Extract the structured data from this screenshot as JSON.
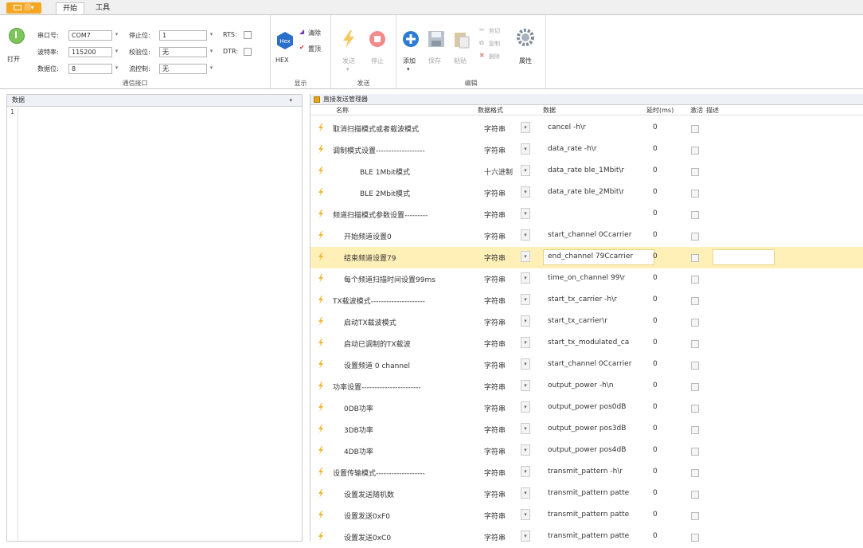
{
  "tabs": {
    "app": "🗐▾",
    "start": "开始",
    "tools": "工具"
  },
  "serial": {
    "port_label": "串口号:",
    "port_value": "COM7",
    "stop_label": "停止位:",
    "stop_value": "1",
    "baud_label": "波特率:",
    "baud_value": "115200",
    "parity_label": "校验位:",
    "parity_value": "无",
    "data_label": "数据位:",
    "data_value": "8",
    "flow_label": "流控制:",
    "flow_value": "无",
    "rts_label": "RTS:",
    "dtr_label": "DTR:",
    "open_label": "打开",
    "group_label": "通信接口"
  },
  "display": {
    "hex_badge": "Hex",
    "hex_label": "HEX",
    "clear_label": "清除",
    "top_label": "置顶",
    "group_label": "显示"
  },
  "send": {
    "send_label": "发送",
    "stop_label": "停止",
    "group_label": "发送"
  },
  "edit": {
    "add_label": "添加",
    "save_label": "保存",
    "paste_label": "粘贴",
    "cut_label": "剪切",
    "copy_label": "复制",
    "delete_label": "删除",
    "props_label": "属性",
    "group_label": "编辑"
  },
  "left_panel": {
    "title": "数据",
    "dropdown": "▾",
    "line1": "1"
  },
  "right_panel": {
    "title": "直接发送管理器",
    "columns": {
      "name": "名称",
      "format": "数据格式",
      "data": "数据",
      "delay": "延时(ms)",
      "active": "激活",
      "desc": "描述"
    },
    "rows": [
      {
        "name": "取消扫描模式或者载波模式",
        "format": "字符串",
        "data": "cancel -h\\r",
        "delay": "0"
      },
      {
        "name": "调制模式设置-------------------",
        "format": "字符串",
        "data": "data_rate -h\\r",
        "delay": "0"
      },
      {
        "name": "BLE 1Mbit模式",
        "format": "十六进制",
        "data": "data_rate ble_1Mbit\\r",
        "delay": "0"
      },
      {
        "name": "BLE 2Mbit模式",
        "format": "字符串",
        "data": "data_rate ble_2Mbit\\r",
        "delay": "0"
      },
      {
        "name": "频道扫描模式参数设置---------",
        "format": "字符串",
        "data": "",
        "delay": "0"
      },
      {
        "name": "开始频道设置0",
        "format": "字符串",
        "data": "start_channel 0Ccarrier",
        "delay": "0"
      },
      {
        "name": "结束频道设置79",
        "format": "字符串",
        "data": "end_channel 79Ccarrier",
        "delay": "0"
      },
      {
        "name": "每个频道扫描时间设置99ms",
        "format": "字符串",
        "data": "time_on_channel 99\\r",
        "delay": "0"
      },
      {
        "name": "TX载波模式---------------------",
        "format": "字符串",
        "data": "start_tx_carrier -h\\r",
        "delay": "0"
      },
      {
        "name": "启动TX载波模式",
        "format": "字符串",
        "data": "start_tx_carrier\\r",
        "delay": "0"
      },
      {
        "name": "启动已调制的TX载波",
        "format": "字符串",
        "data": "start_tx_modulated_ca",
        "delay": "0"
      },
      {
        "name": "设置频道 0 channel",
        "format": "字符串",
        "data": "start_channel 0Ccarrier",
        "delay": "0"
      },
      {
        "name": "功率设置-----------------------",
        "format": "字符串",
        "data": "output_power -h\\n",
        "delay": "0"
      },
      {
        "name": "0DB功率",
        "format": "字符串",
        "data": "output_power pos0dB",
        "delay": "0"
      },
      {
        "name": "3DB功率",
        "format": "字符串",
        "data": "output_power pos3dB",
        "delay": "0"
      },
      {
        "name": "4DB功率",
        "format": "字符串",
        "data": "output_power pos4dB",
        "delay": "0"
      },
      {
        "name": "设置传输模式-------------------",
        "format": "字符串",
        "data": "transmit_pattern -h\\r",
        "delay": "0"
      },
      {
        "name": "设置发送随机数",
        "format": "字符串",
        "data": "transmit_pattern patte",
        "delay": "0"
      },
      {
        "name": "设置发送0xF0",
        "format": "字符串",
        "data": "transmit_pattern patte",
        "delay": "0"
      },
      {
        "name": "设置发送0xC0",
        "format": "字符串",
        "data": "transmit_pattern patte",
        "delay": "0"
      }
    ]
  }
}
